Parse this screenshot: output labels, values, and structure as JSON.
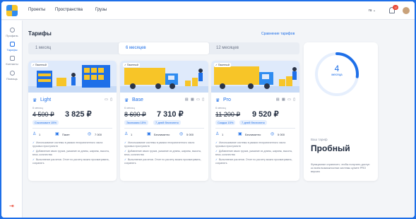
{
  "nav": {
    "projects": "Проекты",
    "spaces": "Пространства",
    "cargo": "Грузы",
    "lang": "ru ⌄",
    "notifications_count": "12"
  },
  "sidebar": {
    "items": [
      {
        "label": "Профиль",
        "icon": "person-icon"
      },
      {
        "label": "Тарифы",
        "icon": "wallet-icon",
        "active": true
      },
      {
        "label": "Контакты",
        "icon": "phone-icon"
      },
      {
        "label": "Помощь",
        "icon": "help-icon"
      }
    ]
  },
  "page": {
    "title": "Тарифы",
    "compare_link": "Сравнение тарифов"
  },
  "tabs": [
    {
      "label": "1 месяц"
    },
    {
      "label": "6 месяцев",
      "active": true
    },
    {
      "label": "12 месяцев"
    }
  ],
  "plans": [
    {
      "hero_label": "✓ Пакетный",
      "name": "Light",
      "icons": "▭ ▯",
      "period": "6 месяц",
      "old_price": "4 500 ₽",
      "new_price": "3 825 ₽",
      "pills": [
        "Сэкономьте 15%"
      ],
      "users": "1",
      "packs": "Пакет",
      "weight": "7 000",
      "features": [
        "Использование системы в рамках неограниченного числа грузовых пространств",
        "Добавление своих грузов, указание их длины, ширины, высоты, веса, количества",
        "Выполнение расчетов. Отчет по расчету можно просматривать, сохранять"
      ]
    },
    {
      "hero_label": "✓ Пакетный",
      "name": "Base",
      "icons": "▤ ▦ ▭ ▯",
      "period": "6 месяц",
      "old_price": "8 600 ₽",
      "new_price": "7 310 ₽",
      "pills": [
        "Экономия 15%",
        "7 дней бесплатно"
      ],
      "users": "1",
      "packs": "Безлимитно",
      "weight": "5 000",
      "features": [
        "Использование системы в рамках неограниченного числа грузовых пространств",
        "Добавление своих грузов, указание их длины, ширины, высоты, веса, количества",
        "Выполнение расчетов. Отчет по расчету можно просматривать, сохранять"
      ]
    },
    {
      "hero_label": "✓ Пакетный",
      "name": "Pro",
      "icons": "▤ ▦ ▭ ▯",
      "period": "6 месяц",
      "old_price": "11 200 ₽",
      "new_price": "9 520 ₽",
      "pills": [
        "Скидка 15%",
        "7 дней бесплатно"
      ],
      "users": "1",
      "packs": "Безлимитно",
      "weight": "5 000",
      "features": [
        "Использование системы в рамках неограниченного числа грузовых пространств",
        "Добавление своих грузов, указание их длины, ширины, высоты, веса, количества",
        "Выполнение расчетов. Отчет по расчету можно просматривать, сохранять"
      ]
    }
  ],
  "trial": {
    "days": "4",
    "days_label": "месяца",
    "remaining_fraction": 0.27,
    "your_plan": "Ваш тариф",
    "name": "Пробный",
    "note": "Функционал ограничен, чтобы получить доступ ко всем возможностям системы купите PRO версию"
  },
  "colors": {
    "accent": "#1e6fe8",
    "alert": "#e8412e"
  }
}
